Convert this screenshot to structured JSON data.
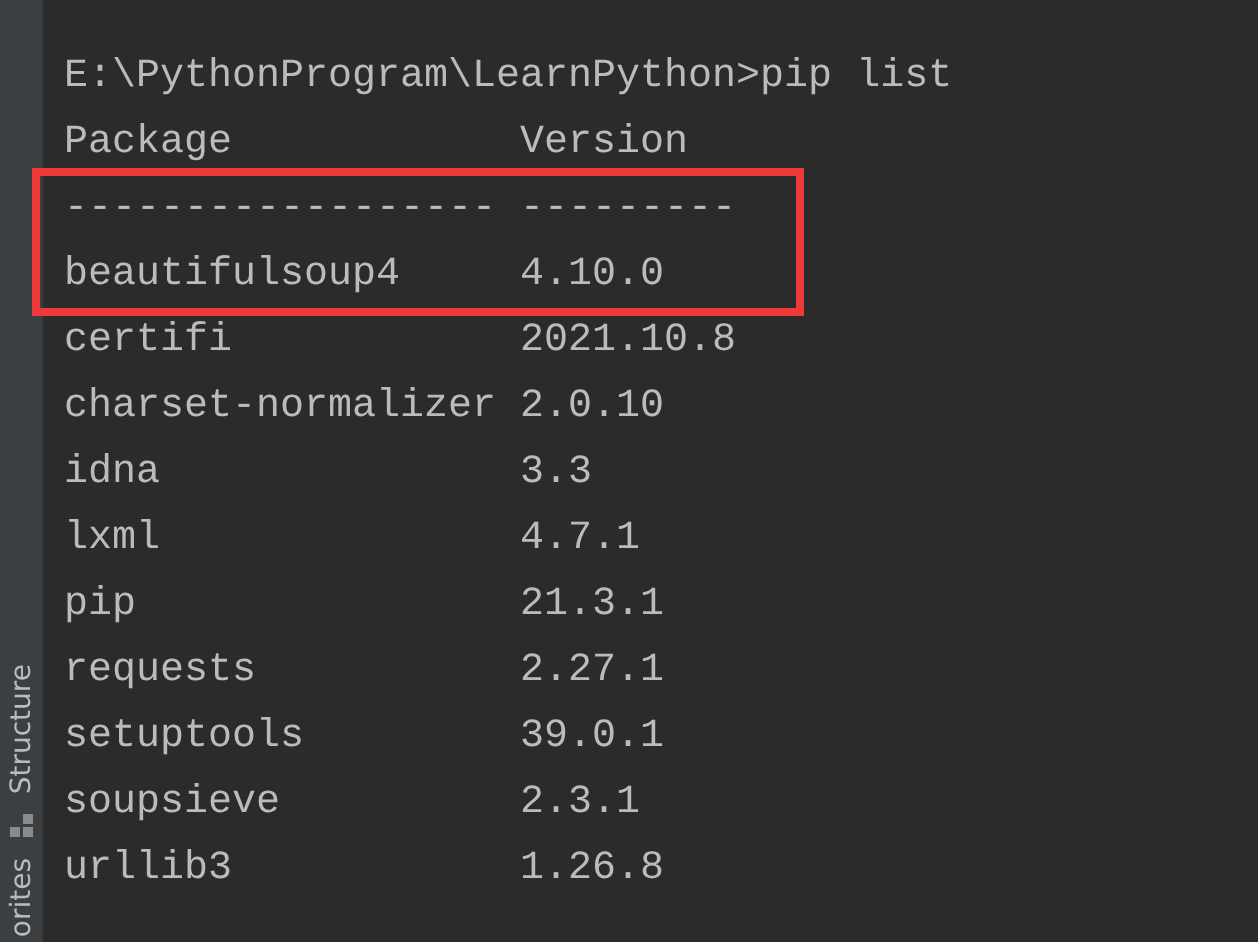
{
  "side_tabs": [
    {
      "label": "Structure",
      "kind": "tool",
      "has_icon": true
    },
    {
      "label": "orites",
      "kind": "tool",
      "has_icon": false
    }
  ],
  "terminal": {
    "command_line": "E:\\PythonProgram\\LearnPython>pip list",
    "rows": [
      {
        "package": "Package",
        "version": "Version",
        "highlighted": false
      },
      {
        "package": "------------------",
        "version": "---------",
        "highlighted": true
      },
      {
        "package": "beautifulsoup4",
        "version": "4.10.0",
        "highlighted": true
      },
      {
        "package": "certifi",
        "version": "2021.10.8",
        "highlighted": false
      },
      {
        "package": "charset-normalizer",
        "version": "2.0.10",
        "highlighted": false
      },
      {
        "package": "idna",
        "version": "3.3",
        "highlighted": false
      },
      {
        "package": "lxml",
        "version": "4.7.1",
        "highlighted": false
      },
      {
        "package": "pip",
        "version": "21.3.1",
        "highlighted": false
      },
      {
        "package": "requests",
        "version": "2.27.1",
        "highlighted": false
      },
      {
        "package": "setuptools",
        "version": "39.0.1",
        "highlighted": false
      },
      {
        "package": "soupsieve",
        "version": "2.3.1",
        "highlighted": false
      },
      {
        "package": "urllib3",
        "version": "1.26.8",
        "highlighted": false
      }
    ]
  }
}
